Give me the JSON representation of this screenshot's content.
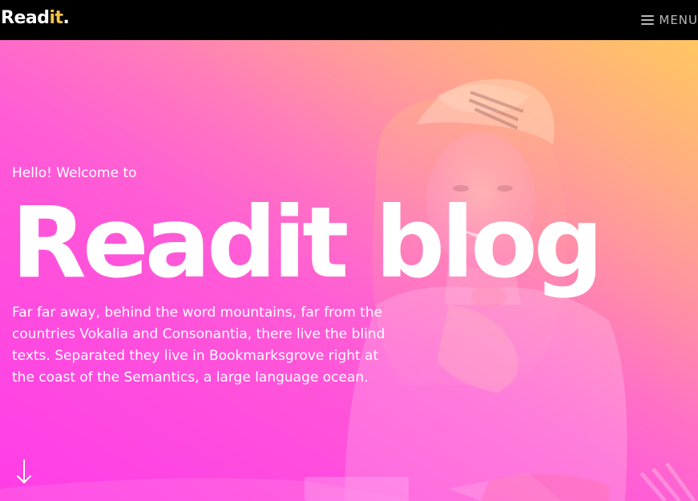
{
  "navbar": {
    "logo_main": "Read",
    "logo_accent": "it",
    "logo_dot": ".",
    "menu_label": "MENU",
    "menu_icon": "hamburger-icon"
  },
  "hero": {
    "subtitle": "Hello! Welcome to",
    "title": "Readit blog",
    "text": "Far far away, behind the word mountains, far from the countries Vokalia and Consonantia, there live the blind texts. Separated they live in Bookmarksgrove right at the coast of the Semantics, a large language ocean.",
    "scroll_icon": "arrow-down-icon"
  },
  "colors": {
    "navbar_bg": "#000000",
    "logo_accent": "#f6c244",
    "menu_text": "#b9b9b9",
    "hero_gradient_top_right": "#ffc36a",
    "hero_gradient_bottom_left": "#ff3ee8",
    "hero_text": "#ffffff"
  }
}
